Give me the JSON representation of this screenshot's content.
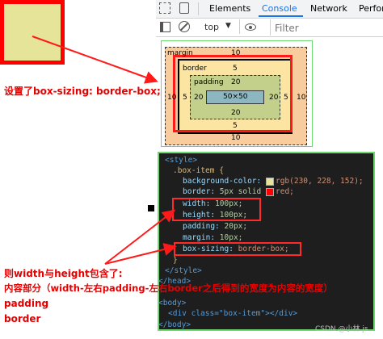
{
  "devtools": {
    "tabs": [
      "Elements",
      "Console",
      "Network",
      "Perfor"
    ],
    "active_tab": "Console",
    "context": "top",
    "filter_placeholder": "Filter"
  },
  "box_model": {
    "margin_label": "margin",
    "margin_top": "10",
    "margin_left": "10",
    "margin_right": "10",
    "margin_bottom": "10",
    "border_label": "border",
    "border_top": "5",
    "border_left": "5",
    "border_right": "5",
    "border_bottom": "5",
    "padding_label": "padding",
    "padding_top": "20",
    "padding_left": "20",
    "padding_right": "20",
    "padding_bottom": "20",
    "content": "50×50"
  },
  "code": {
    "style_open": "<style>",
    "selector": ".box-item {",
    "bg_prop": "background-color:",
    "bg_val": "rgb(230, 228, 152);",
    "border_prop": "border:",
    "border_val1": "5px solid",
    "border_val2": "red;",
    "width_prop": "width:",
    "width_val": "100px;",
    "height_prop": "height:",
    "height_val": "100px;",
    "padding_prop": "padding:",
    "padding_val": "20px;",
    "margin_prop": "margin:",
    "margin_val": "10px;",
    "boxsizing_prop": "box-sizing:",
    "boxsizing_val": "border-box;",
    "brace_close": "}",
    "style_close": "</style>",
    "head_close": "</head>",
    "body_open": "<body>",
    "div_line": "<div class=\"box-item\"></div>",
    "body_close": "</body>"
  },
  "annotations": {
    "box_sizing_note": "设置了box-sizing: border-box;",
    "note_line1": "则width与height包含了:",
    "note_line2": "内容部分（width-左右padding-左右border之后得到的宽度为内容的宽度）",
    "note_line3": "padding",
    "note_line4": "border"
  },
  "colors": {
    "highlight": "#ff1a1a",
    "demo_bg": "#e6e498",
    "margin_bg": "#f9cc9d",
    "border_bg": "#fce5a3",
    "padding_bg": "#c3d08b",
    "content_bg": "#8cb6c0"
  },
  "icons": [
    "inspect-icon",
    "device-toggle-icon",
    "sidebar-toggle-icon",
    "clear-console-icon",
    "dropdown-arrow-icon",
    "eye-icon"
  ],
  "watermark": "CSDN @小林.js"
}
